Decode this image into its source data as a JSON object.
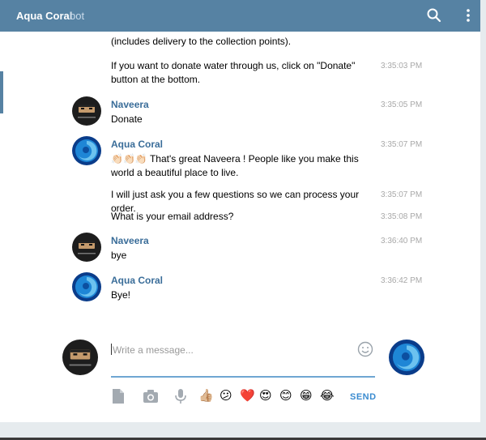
{
  "header": {
    "title": "Aqua Coral",
    "subtitle": "bot",
    "search_icon": "search-icon",
    "menu_icon": "more-vertical-icon"
  },
  "messages": [
    {
      "text": "(includes delivery to the collection points).",
      "time": ""
    },
    {
      "text": "If you want to donate water through us, click on \"Donate\" button at the bottom.",
      "time": "3:35:03 PM"
    },
    {
      "author": "Naveera",
      "text": "Donate",
      "time": "3:35:05 PM"
    },
    {
      "author": "Aqua Coral",
      "emoji": "👏🏻👏🏻👏🏻",
      "text": " That's great Naveera ! People like you make this world a beautiful place to live.",
      "time": "3:35:07 PM"
    },
    {
      "text": "I will just ask you a few questions so we can process your order.",
      "time": "3:35:07 PM"
    },
    {
      "text": "What is your email address?",
      "time": "3:35:08 PM"
    },
    {
      "author": "Naveera",
      "text": "bye",
      "time": "3:36:40 PM"
    },
    {
      "author": "Aqua Coral",
      "text": "Bye!",
      "time": "3:36:42 PM"
    }
  ],
  "composer": {
    "placeholder": "Write a message...",
    "emoji_icon": "smiley-icon"
  },
  "toolbar": {
    "icons": [
      "document-icon",
      "camera-icon",
      "microphone-icon"
    ],
    "quick_emojis": [
      "👍🏼",
      "😕",
      "❤️",
      "😍",
      "😊",
      "😁",
      "😂"
    ],
    "send_label": "SEND"
  },
  "colors": {
    "header_bg": "#5682a3",
    "author": "#3a6d99",
    "send": "#3a8bd0",
    "input_underline": "#6fa6d2"
  }
}
